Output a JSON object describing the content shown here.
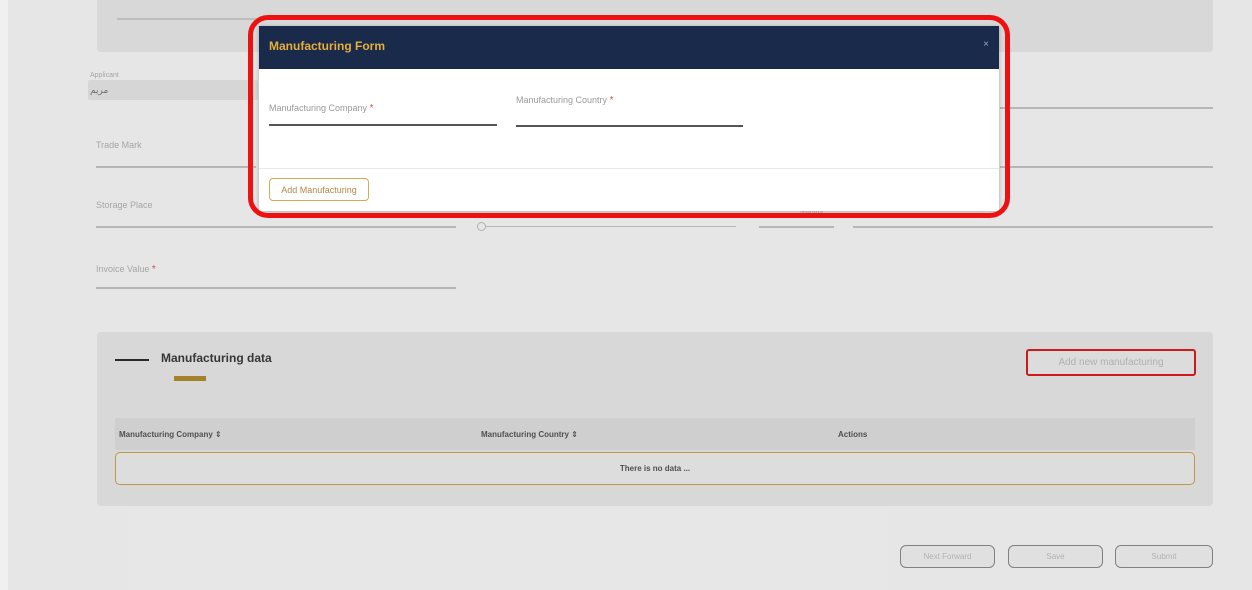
{
  "background": {
    "applicant_label": "Applicant",
    "applicant_value": "مريم",
    "trade_mark_label": "Trade Mark",
    "storage_place_label": "Storage Place",
    "invoice_value_label": "Invoice Value",
    "right_field_label": "Months"
  },
  "manufacturing_section": {
    "title": "Manufacturing data",
    "add_new_button": "Add new manufacturing",
    "columns": [
      "Manufacturing Company ⇕",
      "Manufacturing Country ⇕",
      "Actions"
    ],
    "empty_text": "There is no data ..."
  },
  "footer": {
    "next_forward": "Next Forward",
    "save": "Save",
    "submit": "Submit"
  },
  "modal": {
    "title": "Manufacturing Form",
    "close": "×",
    "company_label": "Manufacturing Company",
    "country_label": "Manufacturing Country",
    "required_mark": "*",
    "add_button": "Add Manufacturing"
  },
  "colors": {
    "modal_header": "#1a2a4a",
    "accent_gold": "#e6ae3a",
    "highlight_red": "#ee1111"
  }
}
